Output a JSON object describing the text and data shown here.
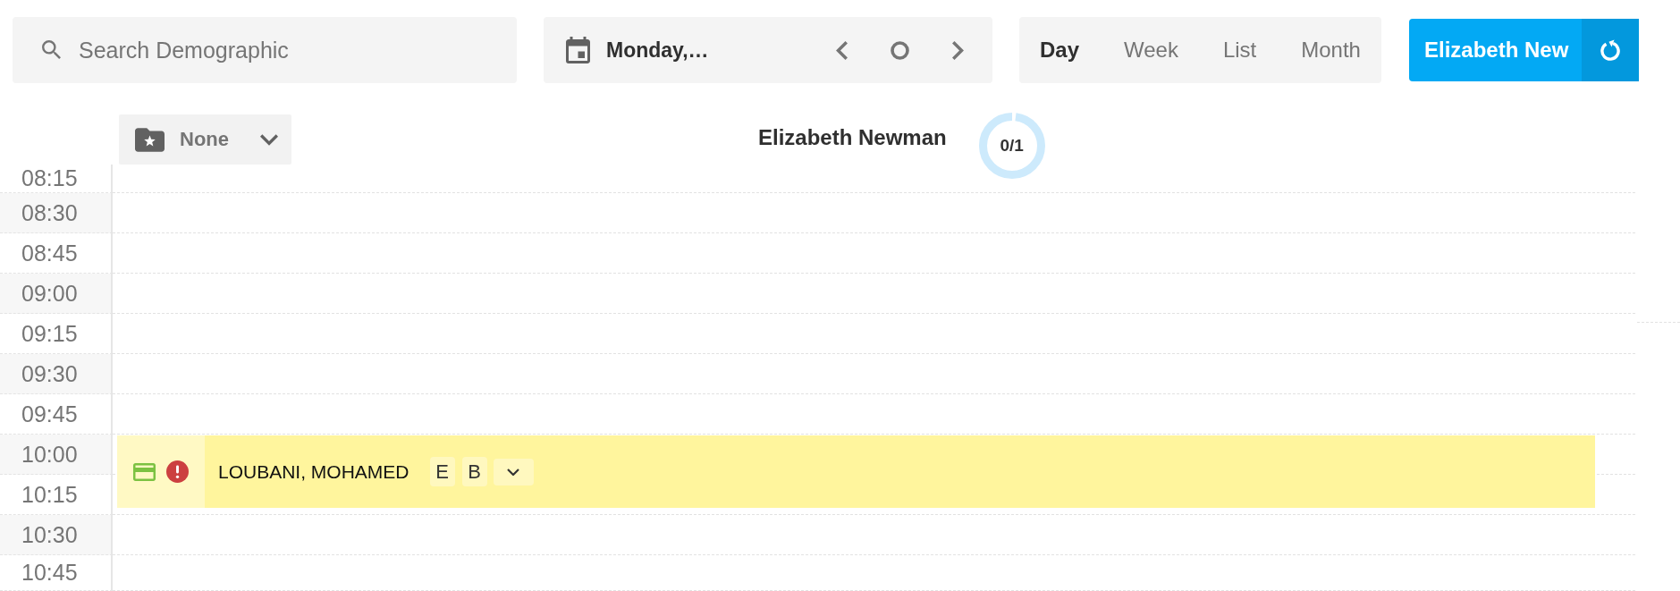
{
  "search": {
    "placeholder": "Search Demographic"
  },
  "date_navigator": {
    "date": "Monday,…"
  },
  "views": [
    {
      "label": "Day",
      "selected": true
    },
    {
      "label": "Week",
      "selected": false
    },
    {
      "label": "List",
      "selected": false
    },
    {
      "label": "Month",
      "selected": false
    }
  ],
  "provider_button": {
    "label": "Elizabeth New"
  },
  "filter": {
    "value": "None"
  },
  "column_header": {
    "provider": "Elizabeth Newman",
    "count": "0/1"
  },
  "time_slots": [
    {
      "time": "08:15"
    },
    {
      "time": "08:30"
    },
    {
      "time": "08:45"
    },
    {
      "time": "09:00"
    },
    {
      "time": "09:15"
    },
    {
      "time": "09:30"
    },
    {
      "time": "09:45"
    },
    {
      "time": "10:00",
      "appointments": [
        {
          "patient": "LOUBANI, MOHAMED",
          "tags": [
            "E",
            "B"
          ],
          "color": "#fff59d"
        }
      ]
    },
    {
      "time": "10:15"
    },
    {
      "time": "10:30"
    },
    {
      "time": "10:45"
    }
  ]
}
